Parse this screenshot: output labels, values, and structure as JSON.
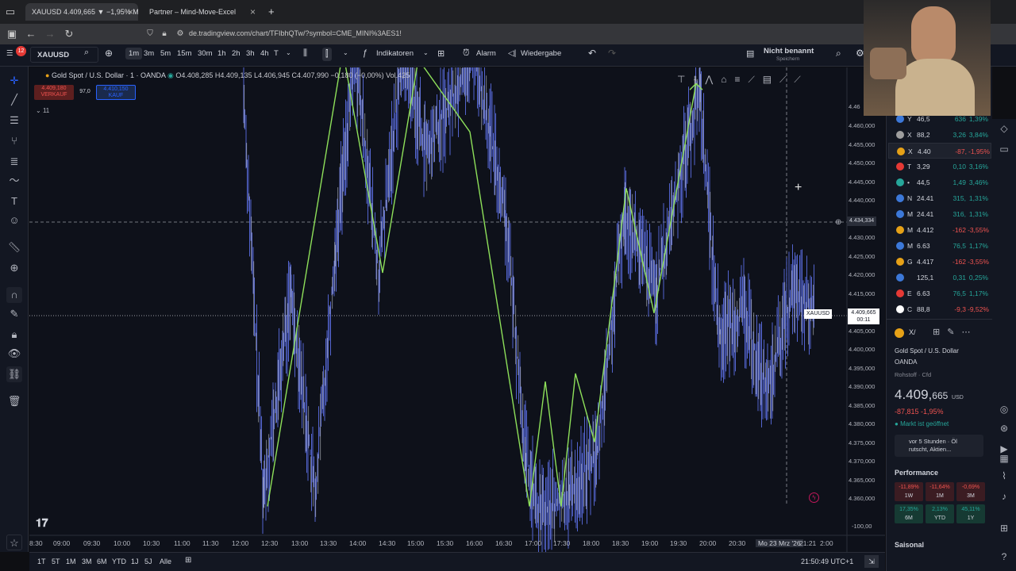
{
  "browser": {
    "tabs": [
      {
        "label": "XAUUSD 4.409,665 ▼ −1,95% M",
        "active": true
      },
      {
        "label": "Partner – Mind-Move-Excel",
        "active": false
      }
    ],
    "new_tab": "+",
    "url": "de.tradingview.com/chart/TFIbhQTw/?symbol=CME_MINI%3AES1!"
  },
  "toolbar": {
    "symbol": "XAUUSD",
    "intervals": [
      "1m",
      "3m",
      "5m",
      "15m",
      "30m",
      "1h",
      "2h",
      "3h",
      "4h",
      "T"
    ],
    "active_interval": "1m",
    "indicators_label": "Indikatoren",
    "alarm_label": "Alarm",
    "replay_label": "Wiedergabe",
    "layout_name": "Nicht benannt",
    "layout_status": "Speichern"
  },
  "legend": {
    "title": "Gold Spot / U.S. Dollar · 1 · OANDA",
    "ohlc": "O4.408,285  H4.409,135  L4.406,945  C4.407,990  −0,180 (−0,00%)  Vol.425",
    "sell_price": "4.409,180",
    "sell_label": "VERKAUF",
    "spread": "97,0",
    "buy_price": "4.410,150",
    "buy_label": "KAUF",
    "collapse": "11"
  },
  "chart_data": {
    "type": "line",
    "xlabel": "",
    "ylabel": "",
    "ylim": [
      4355,
      4465
    ],
    "y_ticks": [
      "4.460,000",
      "4.455,000",
      "4.450,000",
      "4.445,000",
      "4.440,000",
      "4.435,000",
      "4.430,000",
      "4.425,000",
      "4.420,000",
      "4.415,000",
      "4.410,000",
      "4.405,000",
      "4.400,000",
      "4.395,000",
      "4.390,000",
      "4.385,000",
      "4.380,000",
      "4.375,000",
      "4.370,000",
      "4.365,000",
      "4.360,000"
    ],
    "y_top_partial": "4.46",
    "y_bottom": "-100,00",
    "x_ticks": [
      "8:30",
      "09:00",
      "09:30",
      "10:00",
      "10:30",
      "11:00",
      "11:30",
      "12:00",
      "12:30",
      "13:00",
      "13:30",
      "14:00",
      "14:30",
      "15:00",
      "15:30",
      "16:00",
      "16:30",
      "17:00",
      "17:30",
      "18:00",
      "18:30",
      "19:00",
      "19:30",
      "20:00",
      "20:30",
      "Mo 23 Mrz '26",
      "21:21",
      "2:00"
    ],
    "crosshair_price": "4.434,334",
    "last_price_label": "XAUUSD",
    "last_price": "4.409,665",
    "last_countdown": "00:11",
    "series": [
      {
        "name": "",
        "values": []
      },
      {
        "name": "",
        "values": []
      }
    ],
    "grid": false,
    "colors": {
      "price": "#5b6ee1",
      "price_light": "#c7ccd6",
      "zigzag": "#8ee05a"
    }
  },
  "bottom": {
    "ranges": [
      "1T",
      "5T",
      "1M",
      "3M",
      "6M",
      "YTD",
      "1J",
      "5J",
      "Alle"
    ],
    "clock": "21:50:49 UTC+1"
  },
  "watchlist": {
    "rows": [
      {
        "sym": "Y",
        "last": "46,5",
        "chg": "636",
        "pct": "1,39%",
        "dir": "pos",
        "icon": "#3c78d8"
      },
      {
        "sym": "X",
        "last": "88,2",
        "chg": "3,26",
        "pct": "3,84%",
        "dir": "pos",
        "icon": "#9e9e9e"
      },
      {
        "sym": "X",
        "last": "4.40",
        "chg": "-87,",
        "pct": "-1,95%",
        "dir": "neg",
        "icon": "#e6a117"
      },
      {
        "sym": "T",
        "last": "3,29",
        "chg": "0,10",
        "pct": "3,16%",
        "dir": "pos",
        "icon": "#e53935"
      },
      {
        "sym": "•",
        "last": "44,5",
        "chg": "1,49",
        "pct": "3,46%",
        "dir": "pos",
        "icon": "#26a69a"
      },
      {
        "sym": "N",
        "last": "24.41",
        "chg": "315,",
        "pct": "1,31%",
        "dir": "pos",
        "icon": "#3c78d8"
      },
      {
        "sym": "M",
        "last": "24.41",
        "chg": "316,",
        "pct": "1,31%",
        "dir": "pos",
        "icon": "#3c78d8"
      },
      {
        "sym": "M",
        "last": "4.412",
        "chg": "-162",
        "pct": "-3,55%",
        "dir": "neg",
        "icon": "#e6a117"
      },
      {
        "sym": "M",
        "last": "6.63",
        "chg": "76,5",
        "pct": "1,17%",
        "dir": "pos",
        "icon": "#3c78d8"
      },
      {
        "sym": "G",
        "last": "4.417",
        "chg": "-162",
        "pct": "-3,55%",
        "dir": "neg",
        "icon": "#e6a117"
      },
      {
        "sym": "",
        "last": "125,1",
        "chg": "0,31",
        "pct": "0,25%",
        "dir": "pos",
        "icon": "#3c78d8"
      },
      {
        "sym": "E",
        "last": "6.63",
        "chg": "76,5",
        "pct": "1,17%",
        "dir": "pos",
        "icon": "#e53935"
      },
      {
        "sym": "C",
        "last": "88,8",
        "chg": "-9,3",
        "pct": "-9,52%",
        "dir": "neg",
        "icon": "#ffffff"
      }
    ]
  },
  "details": {
    "sym_short": "X/",
    "name": "Gold Spot / U.S. Dollar",
    "exchange": "OANDA",
    "category": "Rohstoff · Cfd",
    "price": "4.409,",
    "price_small": "665",
    "currency": "USD",
    "change": "-87,815  -1,95%",
    "market_status": "Markt ist geöffnet",
    "news": "vor 5 Stunden · Öl rutscht, Aktien...",
    "performance_title": "Performance",
    "performance": [
      {
        "value": "-11,89%",
        "label": "1W",
        "dir": "n"
      },
      {
        "value": "-11,64%",
        "label": "1M",
        "dir": "n"
      },
      {
        "value": "-0,69%",
        "label": "3M",
        "dir": "n"
      },
      {
        "value": "17,35%",
        "label": "6M",
        "dir": "p"
      },
      {
        "value": "2,13%",
        "label": "YTD",
        "dir": "p"
      },
      {
        "value": "45,11%",
        "label": "1Y",
        "dir": "p"
      }
    ],
    "seasonal_title": "Saisonal"
  }
}
